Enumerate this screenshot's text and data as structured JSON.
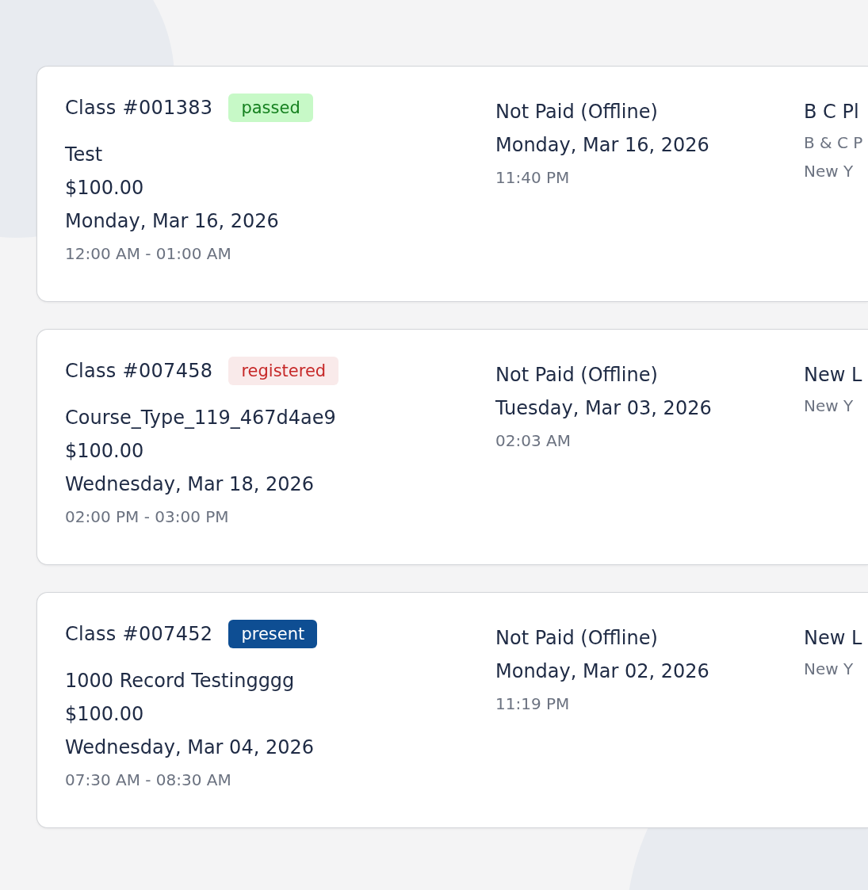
{
  "classes": [
    {
      "title": "Class #001383",
      "status": {
        "label": "passed",
        "kind": "soft",
        "color": "#15801f"
      },
      "course": "Test",
      "price": "$100.00",
      "date": "Monday, Mar 16, 2026",
      "time": "12:00 AM - 01:00 AM",
      "payment": "Not Paid (Offline)",
      "payment_date": "Monday, Mar 16, 2026",
      "payment_time": "11:40 PM",
      "location": [
        "B C Pl",
        "B & C P",
        "New Y"
      ]
    },
    {
      "title": "Class #007458",
      "status": {
        "label": "registered",
        "kind": "soft",
        "color": "#c62828"
      },
      "course": "Course_Type_119_467d4ae9",
      "price": "$100.00",
      "date": "Wednesday, Mar 18, 2026",
      "time": "02:00 PM - 03:00 PM",
      "payment": "Not Paid (Offline)",
      "payment_date": "Tuesday, Mar 03, 2026",
      "payment_time": "02:03 AM",
      "location": [
        "New L",
        "New Y"
      ]
    },
    {
      "title": "Class #007452",
      "status": {
        "label": "present",
        "kind": "solid",
        "color": "#0e4e93"
      },
      "course": "1000 Record Testingggg",
      "price": "$100.00",
      "date": "Wednesday, Mar 04, 2026",
      "time": "07:30 AM - 08:30 AM",
      "payment": "Not Paid (Offline)",
      "payment_date": "Monday, Mar 02, 2026",
      "payment_time": "11:19 PM",
      "location": [
        "New L",
        "New Y"
      ]
    }
  ]
}
